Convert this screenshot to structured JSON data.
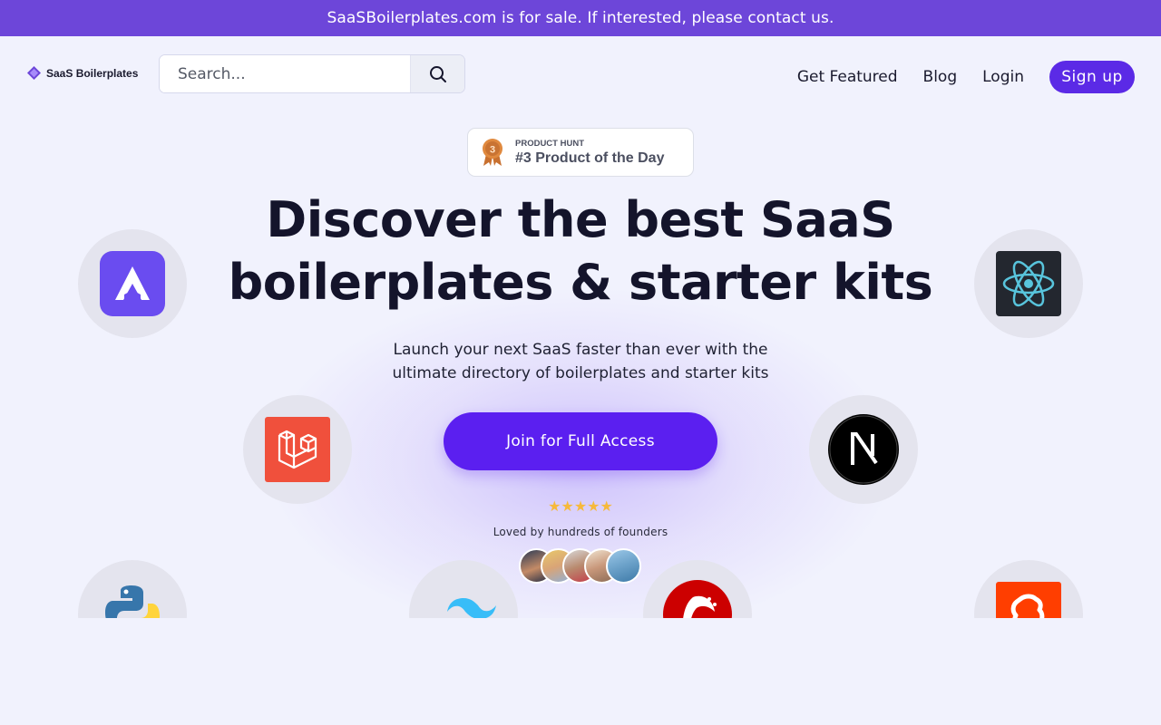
{
  "banner": {
    "text": "SaaSBoilerplates.com is for sale. If interested, please contact us."
  },
  "header": {
    "logo_text": "SaaS Boilerplates",
    "search_placeholder": "Search...",
    "nav": {
      "get_featured": "Get Featured",
      "blog": "Blog",
      "login": "Login",
      "signup": "Sign up"
    }
  },
  "badge": {
    "rank": "3",
    "label": "PRODUCT HUNT",
    "title": "#3 Product of the Day"
  },
  "hero": {
    "title_line1": "Discover the best SaaS",
    "title_line2": "boilerplates & starter kits",
    "subtitle_line1": "Launch your next SaaS faster than ever with the",
    "subtitle_line2": "ultimate directory of boilerplates and starter kits",
    "cta": "Join for Full Access",
    "stars": "★★★★★",
    "loved": "Loved by hundreds of founders"
  },
  "tech_icons": [
    "astro-icon",
    "react-icon",
    "laravel-icon",
    "nextjs-icon",
    "python-icon",
    "tailwind-icon",
    "rails-icon",
    "svelte-icon"
  ],
  "colors": {
    "banner": "#6d46d9",
    "accent": "#5b1ff0",
    "background": "#f1f2fd"
  }
}
